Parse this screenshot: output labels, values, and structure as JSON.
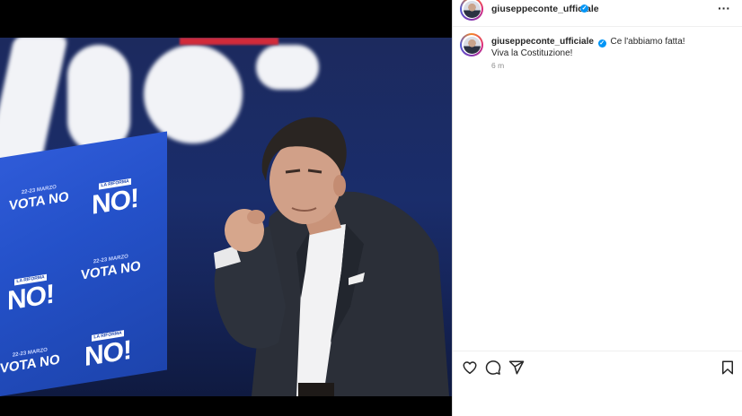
{
  "media": {
    "screen_panels": [
      {
        "mini": "22-23 MARZO",
        "tag": "LA RIFORMA",
        "no": "NO!",
        "vota": "VOTA NO"
      },
      {
        "mini": "22-23 MARZO",
        "tag": "LA RIFORMA",
        "no": "NO!",
        "vota": "VOTA NO"
      },
      {
        "mini": "22-23 MARZO",
        "tag": "LA RIFORMA",
        "no": "NO!",
        "vota": "VOTA NO"
      }
    ]
  },
  "post": {
    "header": {
      "username": "giuseppeconte_ufficiale",
      "verified_mark": "✓",
      "more_icon": "more-options-icon",
      "more_label": "···"
    },
    "caption": {
      "username": "giuseppeconte_ufficiale",
      "text": "Ce l'abbiamo fatta! Viva la Costituzione!",
      "time": "6 m"
    },
    "actions": [
      {
        "name": "like-icon"
      },
      {
        "name": "comment-icon"
      },
      {
        "name": "share-icon"
      },
      {
        "name": "save-icon"
      }
    ]
  },
  "colors": {
    "verified": "#0095f6",
    "text": "#262626",
    "secondary": "#8e8e8e",
    "stage_blue": "#1a2d6b",
    "screen_blue": "#2451c9"
  }
}
